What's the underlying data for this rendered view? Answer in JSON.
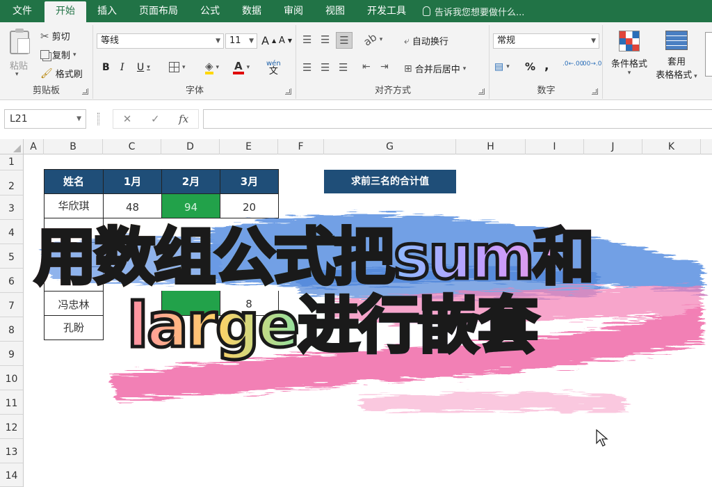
{
  "tabs": [
    "文件",
    "开始",
    "插入",
    "页面布局",
    "公式",
    "数据",
    "审阅",
    "视图",
    "开发工具"
  ],
  "tell_me": "告诉我您想要做什么...",
  "clipboard": {
    "paste": "粘贴",
    "cut": "剪切",
    "copy": "复制",
    "format_painter": "格式刷",
    "label": "剪贴板"
  },
  "font": {
    "name": "等线",
    "size": "11",
    "grow": "A",
    "shrink": "A",
    "phonetic": "wén",
    "bold": "B",
    "italic": "I",
    "underline": "U",
    "label": "字体"
  },
  "alignment": {
    "wrap_text": "自动换行",
    "merge_center": "合并后居中",
    "label": "对齐方式"
  },
  "number": {
    "format": "常规",
    "percent": "%",
    "comma": ",",
    "inc_decimal": ".0←.00",
    "dec_decimal": ".00→.0",
    "label": "数字"
  },
  "styles": {
    "conditional": "条件格式",
    "table_style_1": "套用",
    "table_style_2": "表格格式"
  },
  "formula_bar": {
    "name_box": "L21",
    "cancel": "✕",
    "enter": "✓",
    "fx": "fx"
  },
  "columns": [
    "A",
    "B",
    "C",
    "D",
    "E",
    "F",
    "G",
    "H",
    "I",
    "J",
    "K"
  ],
  "rows": [
    "1",
    "2",
    "3",
    "4",
    "5",
    "6",
    "7",
    "8",
    "9",
    "10",
    "11",
    "12",
    "13",
    "14"
  ],
  "table": {
    "headers": [
      "姓名",
      "1月",
      "2月",
      "3月"
    ],
    "rows": [
      [
        "华欣琪",
        "48",
        "94",
        "20"
      ],
      [
        "",
        "",
        "",
        ""
      ],
      [
        "",
        "",
        "",
        ""
      ],
      [
        "",
        "",
        "",
        ""
      ],
      [
        "冯忠林",
        "",
        "",
        "8"
      ],
      [
        "孔盼",
        "",
        "",
        ""
      ]
    ]
  },
  "sum_label": "求前三名的合计值",
  "headline": {
    "line1": "用数组公式把sum和",
    "line2": "large进行嵌套"
  },
  "colors": {
    "excel_green": "#217346",
    "header_blue": "#1f4e78",
    "highlight_green": "#22a24a",
    "brush_blue": "#5b8fe0",
    "brush_pink": "#f06aa8"
  }
}
